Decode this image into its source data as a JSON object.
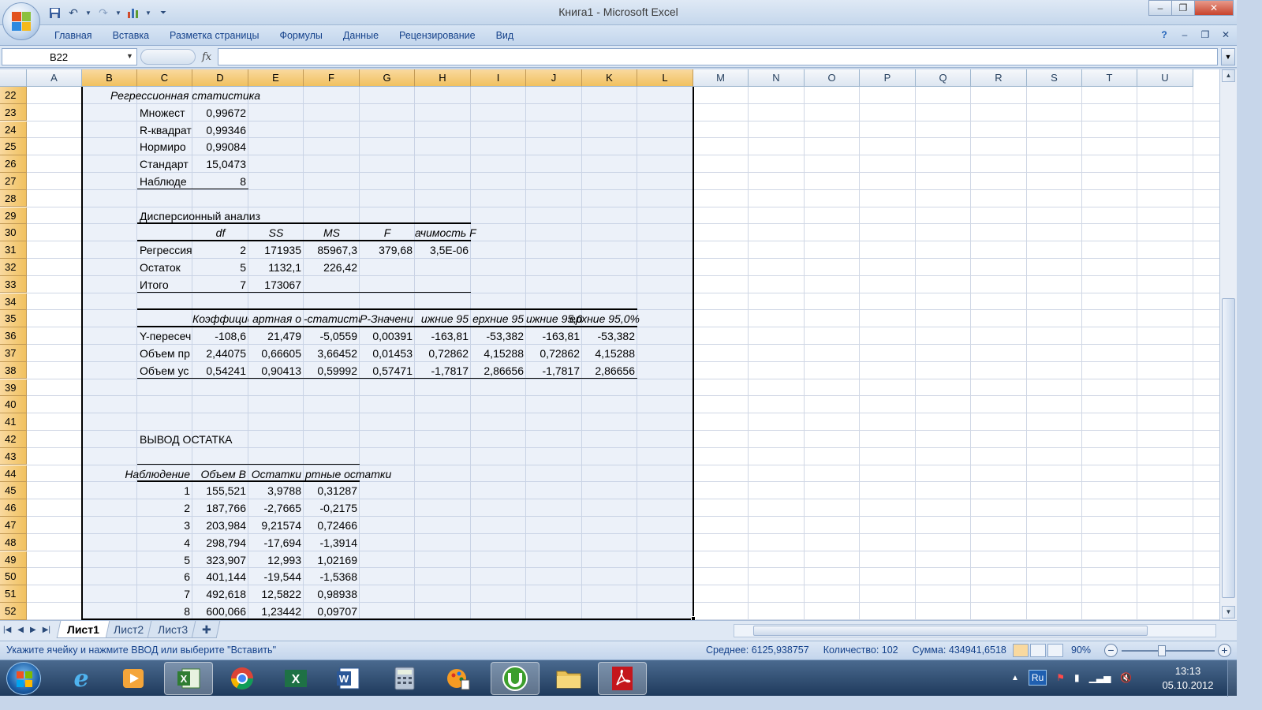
{
  "window": {
    "title": "Книга1 - Microsoft Excel",
    "controls": {
      "minimize": "–",
      "maximize": "❐",
      "close": "✕"
    }
  },
  "quick_access": [
    "save-icon",
    "undo-icon",
    "redo-icon",
    "chart-icon",
    "customize-icon"
  ],
  "ribbon": {
    "tabs": [
      "Главная",
      "Вставка",
      "Разметка страницы",
      "Формулы",
      "Данные",
      "Рецензирование",
      "Вид"
    ],
    "right": {
      "help": "?",
      "min": "–",
      "restore": "❐",
      "close": "✕"
    }
  },
  "formula_bar": {
    "name_box": "B22",
    "fx": "fx",
    "value": ""
  },
  "columns": [
    "A",
    "B",
    "C",
    "D",
    "E",
    "F",
    "G",
    "H",
    "I",
    "J",
    "K",
    "L",
    "M",
    "N",
    "O",
    "P",
    "Q",
    "R",
    "S",
    "T",
    "U"
  ],
  "selected_columns": [
    "B",
    "C",
    "D",
    "E",
    "F",
    "G",
    "H",
    "I",
    "J",
    "K",
    "L"
  ],
  "rows": [
    "22",
    "23",
    "24",
    "25",
    "26",
    "27",
    "28",
    "29",
    "30",
    "31",
    "32",
    "33",
    "34",
    "35",
    "36",
    "37",
    "38",
    "39",
    "40",
    "41",
    "42",
    "43",
    "44",
    "45",
    "46",
    "47",
    "48",
    "49",
    "50",
    "51",
    "52"
  ],
  "sheet": {
    "regression_stats": {
      "title": "Регрессионная статистика",
      "rows": [
        {
          "label": "Множест",
          "value": "0,99672"
        },
        {
          "label": "R-квадрат",
          "value": "0,99346"
        },
        {
          "label": "Нормиро",
          "value": "0,99084"
        },
        {
          "label": "Стандарт",
          "value": "15,0473"
        },
        {
          "label": "Наблюде",
          "value": "8"
        }
      ]
    },
    "anova": {
      "title": "Дисперсионный анализ",
      "headers": [
        "",
        "df",
        "SS",
        "MS",
        "F",
        "ачимость F"
      ],
      "rows": [
        [
          "Регрессия",
          "2",
          "171935",
          "85967,3",
          "379,68",
          "3,5E-06"
        ],
        [
          "Остаток",
          "5",
          "1132,1",
          "226,42",
          "",
          ""
        ],
        [
          "Итого",
          "7",
          "173067",
          "",
          "",
          ""
        ]
      ]
    },
    "coefficients": {
      "headers": [
        "",
        "Коэффициен",
        "артная о",
        "-статисти",
        "Р-Значени",
        "ижние 95",
        "ерхние 95",
        "ижние 95,0",
        "ерхние 95,0%"
      ],
      "rows": [
        [
          "Y-пересеч",
          "-108,6",
          "21,479",
          "-5,0559",
          "0,00391",
          "-163,81",
          "-53,382",
          "-163,81",
          "-53,382"
        ],
        [
          "Объем пр",
          "2,44075",
          "0,66605",
          "3,66452",
          "0,01453",
          "0,72862",
          "4,15288",
          "0,72862",
          "4,15288"
        ],
        [
          "Объем ус",
          "0,54241",
          "0,90413",
          "0,59992",
          "0,57471",
          "-1,7817",
          "2,86656",
          "-1,7817",
          "2,86656"
        ]
      ]
    },
    "residuals": {
      "title": "ВЫВОД ОСТАТКА",
      "headers": [
        "Наблюдение",
        "Объем В",
        "Остатки",
        "ртные остатки"
      ],
      "rows": [
        [
          "1",
          "155,521",
          "3,9788",
          "0,31287"
        ],
        [
          "2",
          "187,766",
          "-2,7665",
          "-0,2175"
        ],
        [
          "3",
          "203,984",
          "9,21574",
          "0,72466"
        ],
        [
          "4",
          "298,794",
          "-17,694",
          "-1,3914"
        ],
        [
          "5",
          "323,907",
          "12,993",
          "1,02169"
        ],
        [
          "6",
          "401,144",
          "-19,544",
          "-1,5368"
        ],
        [
          "7",
          "492,618",
          "12,5822",
          "0,98938"
        ],
        [
          "8",
          "600,066",
          "1,23442",
          "0,09707"
        ]
      ]
    }
  },
  "sheet_tabs": [
    "Лист1",
    "Лист2",
    "Лист3"
  ],
  "active_sheet": "Лист1",
  "status": {
    "message": "Укажите ячейку и нажмите ВВОД или выберите \"Вставить\"",
    "average": "Среднее: 6125,938757",
    "count": "Количество: 102",
    "sum": "Сумма: 434941,6518",
    "zoom": "90%"
  },
  "taskbar": {
    "apps": [
      "windows-start",
      "internet-explorer",
      "media-player",
      "excel",
      "chrome",
      "excel-2",
      "word",
      "calculator",
      "paint",
      "utorrent",
      "folder",
      "acrobat"
    ],
    "language": "Ru",
    "time": "13:13",
    "date": "05.10.2012"
  }
}
